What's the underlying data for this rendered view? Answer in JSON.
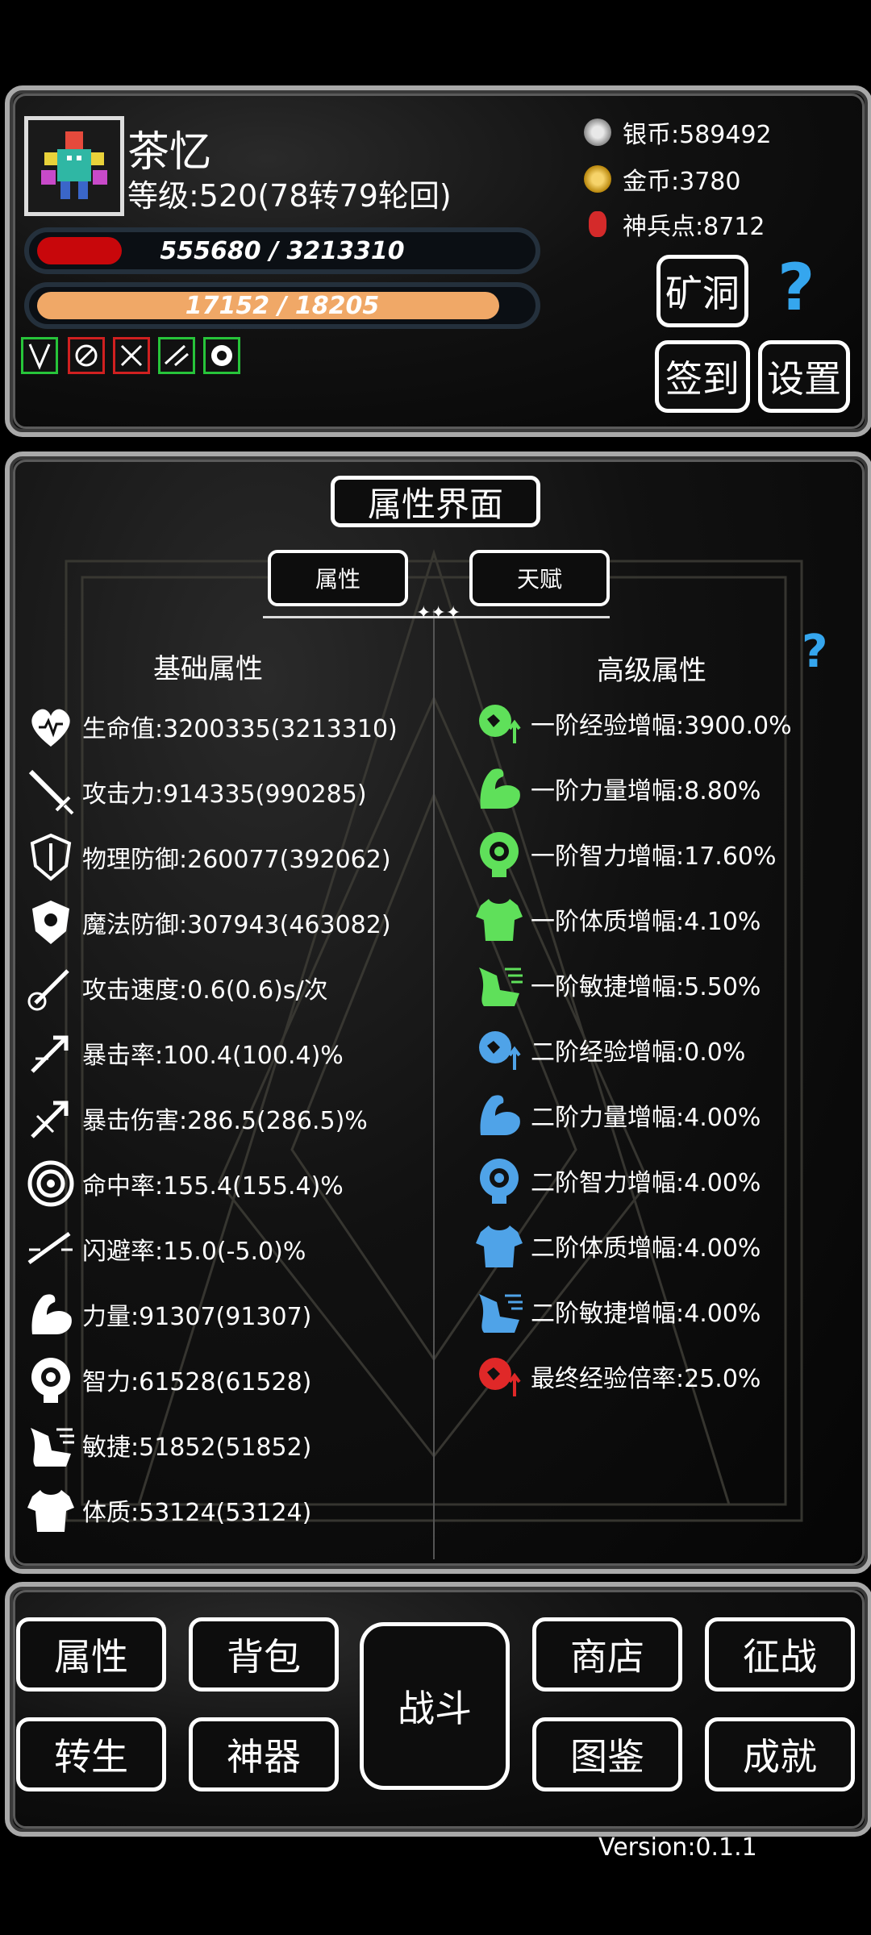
{
  "player": {
    "name": "茶忆",
    "level": "等级:520(78转79轮回)",
    "hp_text": "555680 / 3213310",
    "hp_fraction": 0.173,
    "exp_text": "17152 / 18205",
    "exp_fraction": 0.942
  },
  "currency": {
    "silver": "银币:589492",
    "gold": "金币:3780",
    "divine": "神兵点:8712"
  },
  "top_buttons": {
    "mine": "矿洞",
    "help": "?",
    "signin": "签到",
    "settings": "设置"
  },
  "panel": {
    "title": "属性界面",
    "tab_attr": "属性",
    "tab_talent": "天赋",
    "help": "?",
    "basic_title": "基础属性",
    "advanced_title": "高级属性"
  },
  "basic_stats": [
    {
      "icon": "heart-icon",
      "text": "生命值:3200335(3213310)"
    },
    {
      "icon": "sword-icon",
      "text": "攻击力:914335(990285)"
    },
    {
      "icon": "shield-icon",
      "text": "物理防御:260077(392062)"
    },
    {
      "icon": "magic-shield-icon",
      "text": "魔法防御:307943(463082)"
    },
    {
      "icon": "attack-speed-icon",
      "text": "攻击速度:0.6(0.6)s/次"
    },
    {
      "icon": "crit-rate-icon",
      "text": "暴击率:100.4(100.4)%"
    },
    {
      "icon": "crit-damage-icon",
      "text": "暴击伤害:286.5(286.5)%"
    },
    {
      "icon": "target-icon",
      "text": "命中率:155.4(155.4)%"
    },
    {
      "icon": "dodge-icon",
      "text": "闪避率:15.0(-5.0)%"
    },
    {
      "icon": "arm-icon",
      "text": "力量:91307(91307)"
    },
    {
      "icon": "brain-icon",
      "text": "智力:61528(61528)"
    },
    {
      "icon": "boot-icon",
      "text": "敏捷:51852(51852)"
    },
    {
      "icon": "shirt-icon",
      "text": "体质:53124(53124)"
    }
  ],
  "advanced_stats": [
    {
      "icon": "exp-icon",
      "color": "#5fe05a",
      "text": "一阶经验增幅:3900.0%"
    },
    {
      "icon": "arm-icon",
      "color": "#5fe05a",
      "text": "一阶力量增幅:8.80%"
    },
    {
      "icon": "brain-icon",
      "color": "#5fe05a",
      "text": "一阶智力增幅:17.60%"
    },
    {
      "icon": "shirt-icon",
      "color": "#5fe05a",
      "text": "一阶体质增幅:4.10%"
    },
    {
      "icon": "boot-icon",
      "color": "#5fe05a",
      "text": "一阶敏捷增幅:5.50%"
    },
    {
      "icon": "exp-icon",
      "color": "#4fa3e8",
      "text": "二阶经验增幅:0.0%"
    },
    {
      "icon": "arm-icon",
      "color": "#4fa3e8",
      "text": "二阶力量增幅:4.00%"
    },
    {
      "icon": "brain-icon",
      "color": "#4fa3e8",
      "text": "二阶智力增幅:4.00%"
    },
    {
      "icon": "shirt-icon",
      "color": "#4fa3e8",
      "text": "二阶体质增幅:4.00%"
    },
    {
      "icon": "boot-icon",
      "color": "#4fa3e8",
      "text": "二阶敏捷增幅:4.00%"
    },
    {
      "icon": "exp-icon",
      "color": "#e02828",
      "text": "最终经验倍率:25.0%"
    }
  ],
  "nav": {
    "attr": "属性",
    "bag": "背包",
    "battle": "战斗",
    "shop": "商店",
    "conquest": "征战",
    "rebirth": "转生",
    "artifact": "神器",
    "codex": "图鉴",
    "achievement": "成就"
  },
  "version": "Version:0.1.1",
  "colors": {
    "hp": "#c8070b",
    "exp": "#f0a867",
    "green": "#5fe05a",
    "blue": "#4fa3e8",
    "red": "#e02828"
  }
}
